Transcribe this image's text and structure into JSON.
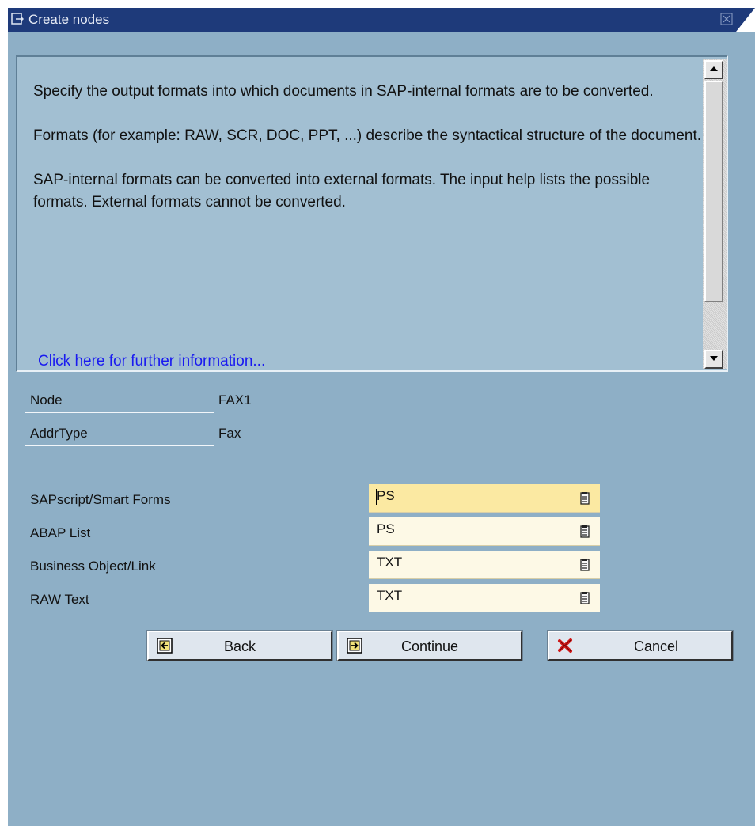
{
  "window": {
    "title": "Create nodes"
  },
  "help": {
    "paragraphs": [
      "Specify the output formats into which documents in SAP-internal formats are to be converted.",
      "Formats (for example: RAW, SCR, DOC, PPT, ...) describe the syntactical structure of the document.",
      "SAP-internal formats can be converted into external formats. The input help lists the possible formats. External formats cannot be converted."
    ],
    "link": "Click here for further information..."
  },
  "info": {
    "node_label": "Node",
    "node_value": "FAX1",
    "addrtype_label": "AddrType",
    "addrtype_value": "Fax"
  },
  "formats": [
    {
      "label": "SAPscript/Smart Forms",
      "value": "PS"
    },
    {
      "label": "ABAP List",
      "value": "PS"
    },
    {
      "label": "Business Object/Link",
      "value": "TXT"
    },
    {
      "label": "RAW Text",
      "value": "TXT"
    }
  ],
  "buttons": {
    "back": "Back",
    "continue": "Continue",
    "cancel": "Cancel"
  },
  "colors": {
    "titlebar": "#1e3a7a",
    "background": "#8eafc6",
    "input_field": "#fdf9e6",
    "focused_field": "#fbe9a2",
    "link": "#1a1af0",
    "cancel_icon": "#d01818"
  }
}
